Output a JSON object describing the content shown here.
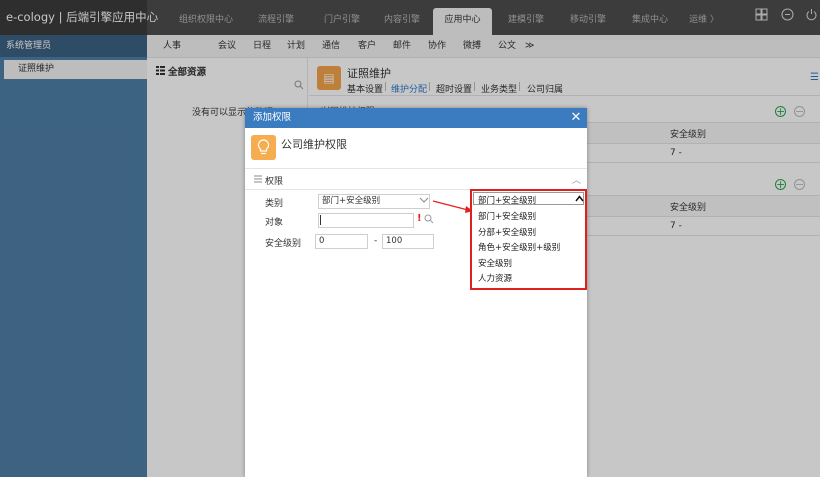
{
  "app": {
    "brand": "e-cology | 后端引擎应用中心"
  },
  "top_tabs": [
    {
      "label": "组织权限中心"
    },
    {
      "label": "流程引擎"
    },
    {
      "label": "门户引擎"
    },
    {
      "label": "内容引擎"
    },
    {
      "label": "应用中心"
    },
    {
      "label": "建模引擎"
    },
    {
      "label": "移动引擎"
    },
    {
      "label": "集成中心"
    },
    {
      "label": "运维 〉"
    }
  ],
  "top_icons": [
    "grid-icon",
    "minus-circle-icon",
    "power-icon"
  ],
  "sidebar": {
    "header": "系统管理员",
    "item": "证照维护"
  },
  "submenu": [
    "人事",
    "会议",
    "日程",
    "计划",
    "通信",
    "客户",
    "邮件",
    "协作",
    "微搏",
    "公文",
    "≫"
  ],
  "tree": {
    "title": "全部资源",
    "empty_text": "没有可以显示的数据"
  },
  "doc": {
    "title": "证照维护",
    "tabs": [
      "基本设置",
      "维护分配",
      "超时设置",
      "业务类型",
      "公司归属"
    ],
    "active_tab": 1
  },
  "bg_table": {
    "partial_header": "·兴网维护权限",
    "col_header": "安全级别",
    "row1_value": "7 -",
    "row2_value": "7 -"
  },
  "dialog": {
    "header": "添加权限",
    "title": "公司维护权限",
    "section": "权限",
    "labels": {
      "category": "类别",
      "object": "对象",
      "security_level": "安全级别"
    },
    "category_value": "部门+安全级别",
    "level_min": "0",
    "level_sep": "-",
    "level_max": "100",
    "required_mark": "!"
  },
  "dropdown": {
    "selected": "部门+安全级别",
    "options": [
      "部门+安全级别",
      "分部+安全级别",
      "角色+安全级别+级别",
      "安全级别",
      "人力资源"
    ]
  },
  "colors": {
    "highlight_border": "#e02020",
    "dialog_header": "#3b7cc0",
    "sidebar": "#4f7fa7"
  }
}
